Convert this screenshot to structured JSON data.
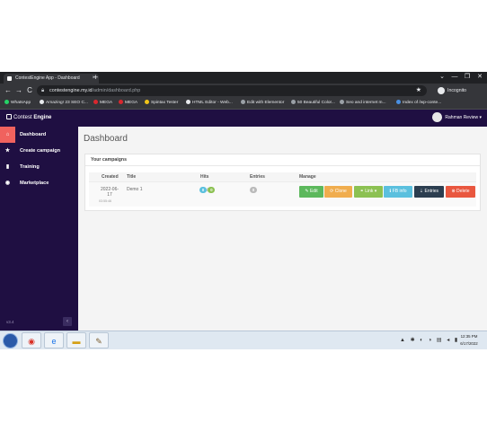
{
  "browser": {
    "tab_title": "ContestEngine App - Dashboard",
    "tab_close": "×",
    "new_tab": "+",
    "window_controls": [
      "⌄",
      "—",
      "❐",
      "✕"
    ],
    "nav": {
      "back": "←",
      "forward": "→",
      "reload": "C"
    },
    "url_host": "contestengine.my.id",
    "url_path": "/admin/dashboard.php",
    "profile": "Incognito",
    "bookmarks": [
      {
        "label": "WhatsApp",
        "color": "#25d366"
      },
      {
        "label": "Amazing! 23 SEO C...",
        "color": "#e8eaed"
      },
      {
        "label": "MEGA",
        "color": "#d9272e"
      },
      {
        "label": "MEGA",
        "color": "#d9272e"
      },
      {
        "label": "Spintax Tester",
        "color": "#f0c419"
      },
      {
        "label": "HTML Editor - Web...",
        "color": "#e8eaed"
      },
      {
        "label": "Edit with Elementor",
        "color": "#9aa0a6"
      },
      {
        "label": "50 Beautiful Color...",
        "color": "#9aa0a6"
      },
      {
        "label": "Seo and internet m...",
        "color": "#9aa0a6"
      },
      {
        "label": "Index of /wp-conte...",
        "color": "#4a90e2"
      }
    ]
  },
  "app": {
    "brand_regular": "Contest ",
    "brand_bold": "Engine",
    "user_name": "Rahman Review",
    "user_caret": "▾",
    "sidebar": {
      "items": [
        {
          "label": "Dashboard",
          "icon": "home-icon",
          "glyph": "⌂"
        },
        {
          "label": "Create campaign",
          "icon": "star-icon",
          "glyph": "★"
        },
        {
          "label": "Training",
          "icon": "book-icon",
          "glyph": "▮"
        },
        {
          "label": "Marketplace",
          "icon": "globe-icon",
          "glyph": "◉"
        }
      ],
      "version": "v3.4",
      "collapse_glyph": "‹"
    },
    "page_title": "Dashboard",
    "card_title": "Your campaigns",
    "table": {
      "columns": [
        "Created",
        "Title",
        "Hits",
        "Entries",
        "Manage"
      ],
      "rows": [
        {
          "created_date": "2022-06-17",
          "created_time": "03:55:46",
          "title": "Demo 1",
          "hits_a": "0",
          "hits_sep": "/",
          "hits_b": "0",
          "entries": "0",
          "actions": [
            {
              "label": "✎ Edit",
              "color": "#5cb85c"
            },
            {
              "label": "⟳ Clone",
              "color": "#f0ad4e"
            },
            {
              "label": "⚭ Link ▾",
              "color": "#8cc152"
            },
            {
              "label": "ℹ FB info",
              "color": "#5bc0de"
            },
            {
              "label": "⇣ Entries",
              "color": "#2c3e50"
            },
            {
              "label": "⊗ Delete",
              "color": "#e9573f"
            }
          ]
        }
      ]
    },
    "colors": {
      "sidebar_bg": "#1f0f42",
      "active_accent": "#f0625e",
      "hits_a": "#5bc0de",
      "hits_b": "#8cc152",
      "entries_badge": "#bbbbbb"
    }
  },
  "taskbar": {
    "apps": [
      "chrome-icon",
      "explorer-icon",
      "folder-icon",
      "paint-icon"
    ],
    "tray_glyphs": "▲ ✱ ◐ ◑ ▤ ◂ ▮",
    "time": "12:35 PM",
    "date": "6/17/2022"
  }
}
